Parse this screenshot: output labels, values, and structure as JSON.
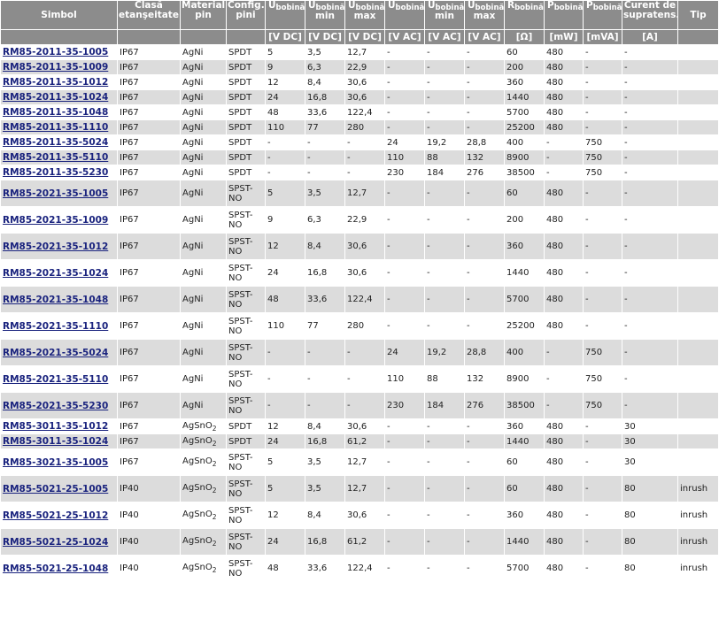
{
  "headers": {
    "simbol": "Simbol",
    "clasa": "Clasă etanşeitate",
    "material": "Material pin",
    "config": "Config. pini",
    "u_dc_base": "U",
    "u_dc_sub": "bobină",
    "u_dc_min_base": "U",
    "u_dc_min_sub": "bobină",
    "u_dc_min_extra": "min",
    "u_dc_max_base": "U",
    "u_dc_max_sub": "bobină",
    "u_dc_max_extra": "max",
    "u_ac_base": "U",
    "u_ac_sub": "bobină",
    "u_ac_min_base": "U",
    "u_ac_min_sub": "bobină",
    "u_ac_min_extra": "min",
    "u_ac_max_base": "U",
    "u_ac_max_sub": "bobină",
    "u_ac_max_extra": "max",
    "r_base": "R",
    "r_sub": "bobină",
    "p_base": "P",
    "p_sub": "bobină",
    "p2_base": "P",
    "p2_sub": "bobină",
    "curent": "Curent de supratens.",
    "tip": "Tip"
  },
  "units": [
    "",
    "",
    "",
    "",
    "[V DC]",
    "[V DC]",
    "[V DC]",
    "[V AC]",
    "[V AC]",
    "[V AC]",
    "[Ω]",
    "[mW]",
    "[mVA]",
    "[A]",
    ""
  ],
  "rows": [
    {
      "simbol": "RM85-2011-35-1005",
      "clasa": "IP67",
      "material": "AgNi",
      "config": "SPDT",
      "u_dc": "5",
      "u_dc_min": "3,5",
      "u_dc_max": "12,7",
      "u_ac": "-",
      "u_ac_min": "-",
      "u_ac_max": "-",
      "r": "60",
      "p": "480",
      "p2": "-",
      "curent": "-",
      "tip": ""
    },
    {
      "simbol": "RM85-2011-35-1009",
      "clasa": "IP67",
      "material": "AgNi",
      "config": "SPDT",
      "u_dc": "9",
      "u_dc_min": "6,3",
      "u_dc_max": "22,9",
      "u_ac": "-",
      "u_ac_min": "-",
      "u_ac_max": "-",
      "r": "200",
      "p": "480",
      "p2": "-",
      "curent": "-",
      "tip": ""
    },
    {
      "simbol": "RM85-2011-35-1012",
      "clasa": "IP67",
      "material": "AgNi",
      "config": "SPDT",
      "u_dc": "12",
      "u_dc_min": "8,4",
      "u_dc_max": "30,6",
      "u_ac": "-",
      "u_ac_min": "-",
      "u_ac_max": "-",
      "r": "360",
      "p": "480",
      "p2": "-",
      "curent": "-",
      "tip": ""
    },
    {
      "simbol": "RM85-2011-35-1024",
      "clasa": "IP67",
      "material": "AgNi",
      "config": "SPDT",
      "u_dc": "24",
      "u_dc_min": "16,8",
      "u_dc_max": "30,6",
      "u_ac": "-",
      "u_ac_min": "-",
      "u_ac_max": "-",
      "r": "1440",
      "p": "480",
      "p2": "-",
      "curent": "-",
      "tip": ""
    },
    {
      "simbol": "RM85-2011-35-1048",
      "clasa": "IP67",
      "material": "AgNi",
      "config": "SPDT",
      "u_dc": "48",
      "u_dc_min": "33,6",
      "u_dc_max": "122,4",
      "u_ac": "-",
      "u_ac_min": "-",
      "u_ac_max": "-",
      "r": "5700",
      "p": "480",
      "p2": "-",
      "curent": "-",
      "tip": ""
    },
    {
      "simbol": "RM85-2011-35-1110",
      "clasa": "IP67",
      "material": "AgNi",
      "config": "SPDT",
      "u_dc": "110",
      "u_dc_min": "77",
      "u_dc_max": "280",
      "u_ac": "-",
      "u_ac_min": "-",
      "u_ac_max": "-",
      "r": "25200",
      "p": "480",
      "p2": "-",
      "curent": "-",
      "tip": ""
    },
    {
      "simbol": "RM85-2011-35-5024",
      "clasa": "IP67",
      "material": "AgNi",
      "config": "SPDT",
      "u_dc": "-",
      "u_dc_min": "-",
      "u_dc_max": "-",
      "u_ac": "24",
      "u_ac_min": "19,2",
      "u_ac_max": "28,8",
      "r": "400",
      "p": "-",
      "p2": "750",
      "curent": "-",
      "tip": ""
    },
    {
      "simbol": "RM85-2011-35-5110",
      "clasa": "IP67",
      "material": "AgNi",
      "config": "SPDT",
      "u_dc": "-",
      "u_dc_min": "-",
      "u_dc_max": "-",
      "u_ac": "110",
      "u_ac_min": "88",
      "u_ac_max": "132",
      "r": "8900",
      "p": "-",
      "p2": "750",
      "curent": "-",
      "tip": ""
    },
    {
      "simbol": "RM85-2011-35-5230",
      "clasa": "IP67",
      "material": "AgNi",
      "config": "SPDT",
      "u_dc": "-",
      "u_dc_min": "-",
      "u_dc_max": "-",
      "u_ac": "230",
      "u_ac_min": "184",
      "u_ac_max": "276",
      "r": "38500",
      "p": "-",
      "p2": "750",
      "curent": "-",
      "tip": ""
    },
    {
      "simbol": "RM85-2021-35-1005",
      "clasa": "IP67",
      "material": "AgNi",
      "config": "SPST-NO",
      "u_dc": "5",
      "u_dc_min": "3,5",
      "u_dc_max": "12,7",
      "u_ac": "-",
      "u_ac_min": "-",
      "u_ac_max": "-",
      "r": "60",
      "p": "480",
      "p2": "-",
      "curent": "-",
      "tip": ""
    },
    {
      "simbol": "RM85-2021-35-1009",
      "clasa": "IP67",
      "material": "AgNi",
      "config": "SPST-NO",
      "u_dc": "9",
      "u_dc_min": "6,3",
      "u_dc_max": "22,9",
      "u_ac": "-",
      "u_ac_min": "-",
      "u_ac_max": "-",
      "r": "200",
      "p": "480",
      "p2": "-",
      "curent": "-",
      "tip": ""
    },
    {
      "simbol": "RM85-2021-35-1012",
      "clasa": "IP67",
      "material": "AgNi",
      "config": "SPST-NO",
      "u_dc": "12",
      "u_dc_min": "8,4",
      "u_dc_max": "30,6",
      "u_ac": "-",
      "u_ac_min": "-",
      "u_ac_max": "-",
      "r": "360",
      "p": "480",
      "p2": "-",
      "curent": "-",
      "tip": ""
    },
    {
      "simbol": "RM85-2021-35-1024",
      "clasa": "IP67",
      "material": "AgNi",
      "config": "SPST-NO",
      "u_dc": "24",
      "u_dc_min": "16,8",
      "u_dc_max": "30,6",
      "u_ac": "-",
      "u_ac_min": "-",
      "u_ac_max": "-",
      "r": "1440",
      "p": "480",
      "p2": "-",
      "curent": "-",
      "tip": ""
    },
    {
      "simbol": "RM85-2021-35-1048",
      "clasa": "IP67",
      "material": "AgNi",
      "config": "SPST-NO",
      "u_dc": "48",
      "u_dc_min": "33,6",
      "u_dc_max": "122,4",
      "u_ac": "-",
      "u_ac_min": "-",
      "u_ac_max": "-",
      "r": "5700",
      "p": "480",
      "p2": "-",
      "curent": "-",
      "tip": ""
    },
    {
      "simbol": "RM85-2021-35-1110",
      "clasa": "IP67",
      "material": "AgNi",
      "config": "SPST-NO",
      "u_dc": "110",
      "u_dc_min": "77",
      "u_dc_max": "280",
      "u_ac": "-",
      "u_ac_min": "-",
      "u_ac_max": "-",
      "r": "25200",
      "p": "480",
      "p2": "-",
      "curent": "-",
      "tip": ""
    },
    {
      "simbol": "RM85-2021-35-5024",
      "clasa": "IP67",
      "material": "AgNi",
      "config": "SPST-NO",
      "u_dc": "-",
      "u_dc_min": "-",
      "u_dc_max": "-",
      "u_ac": "24",
      "u_ac_min": "19,2",
      "u_ac_max": "28,8",
      "r": "400",
      "p": "-",
      "p2": "750",
      "curent": "-",
      "tip": ""
    },
    {
      "simbol": "RM85-2021-35-5110",
      "clasa": "IP67",
      "material": "AgNi",
      "config": "SPST-NO",
      "u_dc": "-",
      "u_dc_min": "-",
      "u_dc_max": "-",
      "u_ac": "110",
      "u_ac_min": "88",
      "u_ac_max": "132",
      "r": "8900",
      "p": "-",
      "p2": "750",
      "curent": "-",
      "tip": ""
    },
    {
      "simbol": "RM85-2021-35-5230",
      "clasa": "IP67",
      "material": "AgNi",
      "config": "SPST-NO",
      "u_dc": "-",
      "u_dc_min": "-",
      "u_dc_max": "-",
      "u_ac": "230",
      "u_ac_min": "184",
      "u_ac_max": "276",
      "r": "38500",
      "p": "-",
      "p2": "750",
      "curent": "-",
      "tip": ""
    },
    {
      "simbol": "RM85-3011-35-1012",
      "clasa": "IP67",
      "material": "AgSnO",
      "material_sub": "2",
      "config": "SPDT",
      "u_dc": "12",
      "u_dc_min": "8,4",
      "u_dc_max": "30,6",
      "u_ac": "-",
      "u_ac_min": "-",
      "u_ac_max": "-",
      "r": "360",
      "p": "480",
      "p2": "-",
      "curent": "30",
      "tip": ""
    },
    {
      "simbol": "RM85-3011-35-1024",
      "clasa": "IP67",
      "material": "AgSnO",
      "material_sub": "2",
      "config": "SPDT",
      "u_dc": "24",
      "u_dc_min": "16,8",
      "u_dc_max": "61,2",
      "u_ac": "-",
      "u_ac_min": "-",
      "u_ac_max": "-",
      "r": "1440",
      "p": "480",
      "p2": "-",
      "curent": "30",
      "tip": ""
    },
    {
      "simbol": "RM85-3021-35-1005",
      "clasa": "IP67",
      "material": "AgSnO",
      "material_sub": "2",
      "config": "SPST-NO",
      "u_dc": "5",
      "u_dc_min": "3,5",
      "u_dc_max": "12,7",
      "u_ac": "-",
      "u_ac_min": "-",
      "u_ac_max": "-",
      "r": "60",
      "p": "480",
      "p2": "-",
      "curent": "30",
      "tip": ""
    },
    {
      "simbol": "RM85-5021-25-1005",
      "clasa": "IP40",
      "material": "AgSnO",
      "material_sub": "2",
      "config": "SPST-NO",
      "u_dc": "5",
      "u_dc_min": "3,5",
      "u_dc_max": "12,7",
      "u_ac": "-",
      "u_ac_min": "-",
      "u_ac_max": "-",
      "r": "60",
      "p": "480",
      "p2": "-",
      "curent": "80",
      "tip": "inrush"
    },
    {
      "simbol": "RM85-5021-25-1012",
      "clasa": "IP40",
      "material": "AgSnO",
      "material_sub": "2",
      "config": "SPST-NO",
      "u_dc": "12",
      "u_dc_min": "8,4",
      "u_dc_max": "30,6",
      "u_ac": "-",
      "u_ac_min": "-",
      "u_ac_max": "-",
      "r": "360",
      "p": "480",
      "p2": "-",
      "curent": "80",
      "tip": "inrush"
    },
    {
      "simbol": "RM85-5021-25-1024",
      "clasa": "IP40",
      "material": "AgSnO",
      "material_sub": "2",
      "config": "SPST-NO",
      "u_dc": "24",
      "u_dc_min": "16,8",
      "u_dc_max": "61,2",
      "u_ac": "-",
      "u_ac_min": "-",
      "u_ac_max": "-",
      "r": "1440",
      "p": "480",
      "p2": "-",
      "curent": "80",
      "tip": "inrush"
    },
    {
      "simbol": "RM85-5021-25-1048",
      "clasa": "IP40",
      "material": "AgSnO",
      "material_sub": "2",
      "config": "SPST-NO",
      "u_dc": "48",
      "u_dc_min": "33,6",
      "u_dc_max": "122,4",
      "u_ac": "-",
      "u_ac_min": "-",
      "u_ac_max": "-",
      "r": "5700",
      "p": "480",
      "p2": "-",
      "curent": "80",
      "tip": "inrush"
    }
  ]
}
